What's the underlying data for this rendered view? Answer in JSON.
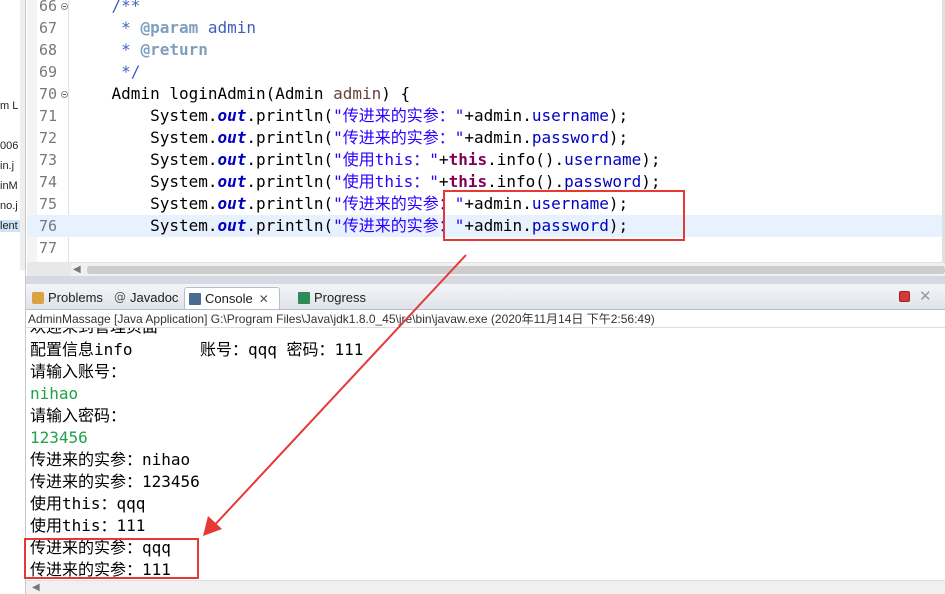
{
  "explorer": {
    "fragments": [
      "m L",
      "006",
      "in.j",
      "inM",
      "no.j",
      "lent"
    ]
  },
  "editor": {
    "lines": [
      {
        "n": "66",
        "fold": true,
        "segs": [
          [
            "cm",
            "    /**"
          ]
        ]
      },
      {
        "n": "67",
        "fold": false,
        "segs": [
          [
            "cm",
            "     * "
          ],
          [
            "tag",
            "@param"
          ],
          [
            "cm",
            " admin"
          ]
        ]
      },
      {
        "n": "68",
        "fold": false,
        "segs": [
          [
            "cm",
            "     * "
          ],
          [
            "tag",
            "@return"
          ]
        ]
      },
      {
        "n": "69",
        "fold": false,
        "segs": [
          [
            "cm",
            "     */"
          ]
        ]
      },
      {
        "n": "70",
        "fold": true,
        "segs": [
          [
            "",
            "    Admin loginAdmin(Admin "
          ],
          [
            "pm",
            "admin"
          ],
          [
            "",
            ") {"
          ]
        ]
      },
      {
        "n": "71",
        "fold": false,
        "segs": [
          [
            "",
            "        System."
          ],
          [
            "sf",
            "out"
          ],
          [
            "",
            ".println("
          ],
          [
            "st",
            "\"传进来的实参：\""
          ],
          [
            "",
            "+admin."
          ],
          [
            "fd",
            "username"
          ],
          [
            "",
            ");"
          ]
        ]
      },
      {
        "n": "72",
        "fold": false,
        "segs": [
          [
            "",
            "        System."
          ],
          [
            "sf",
            "out"
          ],
          [
            "",
            ".println("
          ],
          [
            "st",
            "\"传进来的实参：\""
          ],
          [
            "",
            "+admin."
          ],
          [
            "fd",
            "password"
          ],
          [
            "",
            ");"
          ]
        ]
      },
      {
        "n": "73",
        "fold": false,
        "segs": [
          [
            "",
            "        System."
          ],
          [
            "sf",
            "out"
          ],
          [
            "",
            ".println("
          ],
          [
            "st",
            "\"使用this：\""
          ],
          [
            "",
            "+"
          ],
          [
            "kw",
            "this"
          ],
          [
            "",
            ".info()."
          ],
          [
            "fd",
            "username"
          ],
          [
            "",
            ");"
          ]
        ]
      },
      {
        "n": "74",
        "fold": false,
        "segs": [
          [
            "",
            "        System."
          ],
          [
            "sf",
            "out"
          ],
          [
            "",
            ".println("
          ],
          [
            "st",
            "\"使用this：\""
          ],
          [
            "",
            "+"
          ],
          [
            "kw",
            "this"
          ],
          [
            "",
            ".info()."
          ],
          [
            "fd",
            "password"
          ],
          [
            "",
            ");"
          ]
        ]
      },
      {
        "n": "75",
        "fold": false,
        "segs": [
          [
            "",
            "        System."
          ],
          [
            "sf",
            "out"
          ],
          [
            "",
            ".println("
          ],
          [
            "st",
            "\"传进来的实参：\""
          ],
          [
            "",
            "+admin."
          ],
          [
            "fd",
            "username"
          ],
          [
            "",
            ");"
          ]
        ]
      },
      {
        "n": "76",
        "fold": false,
        "current": true,
        "segs": [
          [
            "",
            "        System."
          ],
          [
            "sf",
            "out"
          ],
          [
            "",
            ".println("
          ],
          [
            "st",
            "\"传进来的实参：\""
          ],
          [
            "",
            "+admin."
          ],
          [
            "fd",
            "password"
          ],
          [
            "",
            ");"
          ]
        ]
      },
      {
        "n": "77",
        "fold": false,
        "segs": [
          [
            "",
            ""
          ]
        ]
      }
    ]
  },
  "tabs": [
    {
      "label": "Problems",
      "icon": "problems-icon"
    },
    {
      "label": "Javadoc",
      "icon": "javadoc-icon"
    },
    {
      "label": "Console",
      "icon": "console-icon",
      "active": true,
      "close": "✕"
    },
    {
      "label": "Progress",
      "icon": "progress-icon"
    }
  ],
  "console": {
    "header": "AdminMassage [Java Application] G:\\Program Files\\Java\\jdk1.8.0_45\\jre\\bin\\javaw.exe (2020年11月14日 下午2:56:49)",
    "partial_line": "欢迎来到管理页面~",
    "lines": [
      {
        "text": "配置信息info       账号：qqq 密码：111",
        "input": false
      },
      {
        "text": "请输入账号：",
        "input": false
      },
      {
        "text": "nihao",
        "input": true
      },
      {
        "text": "请输入密码：",
        "input": false
      },
      {
        "text": "123456",
        "input": true
      },
      {
        "text": "传进来的实参：nihao",
        "input": false
      },
      {
        "text": "传进来的实参：123456",
        "input": false
      },
      {
        "text": "使用this：qqq",
        "input": false
      },
      {
        "text": "使用this：111",
        "input": false
      },
      {
        "text": "传进来的实参：qqq",
        "input": false
      },
      {
        "text": "传进来的实参：111",
        "input": false
      }
    ]
  },
  "colors": {
    "annotation": "#e53935",
    "input_text": "#1ea34b"
  }
}
